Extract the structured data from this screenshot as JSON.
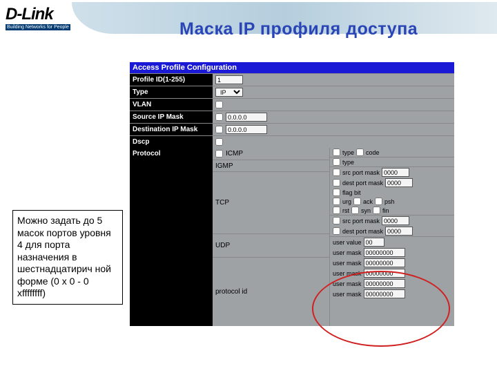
{
  "brand": {
    "name": "D-Link",
    "tagline": "Building Networks for People"
  },
  "page_title": "Маска IP профиля доступа",
  "panel": {
    "title": "Access Profile Configuration",
    "profile_id_label": "Profile ID(1-255)",
    "profile_id_value": "1",
    "type_label": "Type",
    "type_value": "IP",
    "vlan_label": "VLAN",
    "src_mask_label": "Source IP Mask",
    "src_mask_value": "0.0.0.0",
    "dst_mask_label": "Destination IP Mask",
    "dst_mask_value": "0.0.0.0",
    "dscp_label": "Dscp",
    "protocol_label": "Protocol",
    "proto": {
      "icmp": "ICMP",
      "icmp_type": "type",
      "icmp_code": "code",
      "igmp": "IGMP",
      "igmp_type": "type",
      "tcp": "TCP",
      "src_port_mask": "src port mask",
      "src_port_mask_val": "0000",
      "dst_port_mask": "dest port mask",
      "dst_port_mask_val": "0000",
      "flag_bit": "flag bit",
      "f_urg": "urg",
      "f_ack": "ack",
      "f_psh": "psh",
      "f_rst": "rst",
      "f_syn": "syn",
      "f_fin": "fin",
      "udp": "UDP",
      "udp_src_mask": "src port mask",
      "udp_src_val": "0000",
      "udp_dst_mask": "dest port mask",
      "udp_dst_val": "0000",
      "protocol_id": "protocol id",
      "user_value": "user value",
      "user_value_val": "00",
      "user_mask": "user mask",
      "user_mask_val": "00000000"
    }
  },
  "note": "Можно задать до 5 масок портов уровня 4 для порта назначения в шестнадцатирич ной форме (0 x 0 - 0 xffffffff)"
}
